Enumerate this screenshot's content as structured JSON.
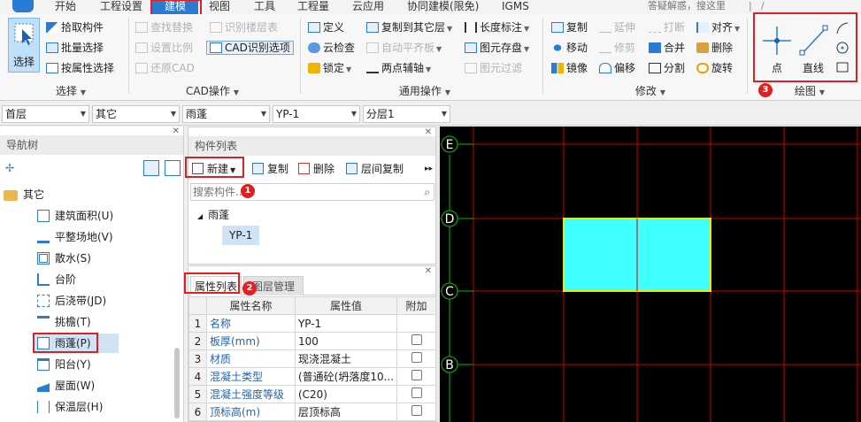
{
  "menu": {
    "items": [
      "开始",
      "工程设置",
      "建模",
      "视图",
      "工具",
      "工程量",
      "云应用",
      "协同建模(限免)",
      "IGMS"
    ],
    "active": "建模",
    "search_placeholder": "答疑解惑，搜这里"
  },
  "ribbon": {
    "select_group": {
      "label": "选择",
      "big_button": "选择",
      "buttons": [
        "拾取构件",
        "批量选择",
        "按属性选择"
      ]
    },
    "cad_group": {
      "label": "CAD操作",
      "buttons": [
        "查找替换",
        "识别楼层表",
        "设置比例",
        "CAD识别选项",
        "还原CAD"
      ]
    },
    "common_group": {
      "label": "通用操作",
      "buttons": [
        "定义",
        "复制到其它层",
        "长度标注",
        "云检查",
        "自动平齐板",
        "图元存盘",
        "锁定",
        "两点辅轴",
        "图元过滤"
      ]
    },
    "modify_group": {
      "label": "修改",
      "buttons": [
        "复制",
        "延伸",
        "打断",
        "对齐",
        "移动",
        "修剪",
        "合并",
        "删除",
        "镜像",
        "偏移",
        "分割",
        "旋转"
      ]
    },
    "draw_group": {
      "label": "绘图",
      "buttons": [
        "点",
        "直线"
      ]
    }
  },
  "selectors": [
    "首层",
    "其它",
    "雨蓬",
    "YP-1",
    "分层1"
  ],
  "nav_tree": {
    "title": "导航树",
    "category": "其它",
    "items": [
      "建筑面积(U)",
      "平整场地(V)",
      "散水(S)",
      "台阶",
      "后浇带(JD)",
      "挑檐(T)",
      "雨蓬(P)",
      "阳台(Y)",
      "屋面(W)",
      "保温层(H)"
    ],
    "selected": "雨蓬(P)"
  },
  "component_list": {
    "title": "构件列表",
    "toolbar": [
      "新建",
      "复制",
      "删除",
      "层间复制"
    ],
    "search_placeholder": "搜索构件...",
    "group": "雨蓬",
    "items": [
      "YP-1"
    ]
  },
  "attributes": {
    "tabs": [
      "属性列表",
      "图层管理"
    ],
    "headers": [
      "属性名称",
      "属性值",
      "附加"
    ],
    "rows": [
      {
        "no": "1",
        "name": "名称",
        "value": "YP-1",
        "attach": false
      },
      {
        "no": "2",
        "name": "板厚(mm)",
        "value": "100",
        "attach": true
      },
      {
        "no": "3",
        "name": "材质",
        "value": "现浇混凝土",
        "attach": true
      },
      {
        "no": "4",
        "name": "混凝土类型",
        "value": "(普通砼(坍落度10...",
        "attach": true
      },
      {
        "no": "5",
        "name": "混凝土强度等级",
        "value": "(C20)",
        "attach": true
      },
      {
        "no": "6",
        "name": "顶标高(m)",
        "value": "层顶标高",
        "attach": true
      }
    ]
  },
  "canvas": {
    "axis_labels": [
      "E",
      "D",
      "C",
      "B"
    ]
  },
  "badges": [
    "1",
    "2",
    "3"
  ],
  "colors": {
    "accent": "#2b79d2",
    "highlight_red": "#e02020",
    "grid_red": "#d00000",
    "axis_green": "#00c000",
    "slab_cyan": "#40ffff",
    "slab_border": "#e8e800"
  }
}
